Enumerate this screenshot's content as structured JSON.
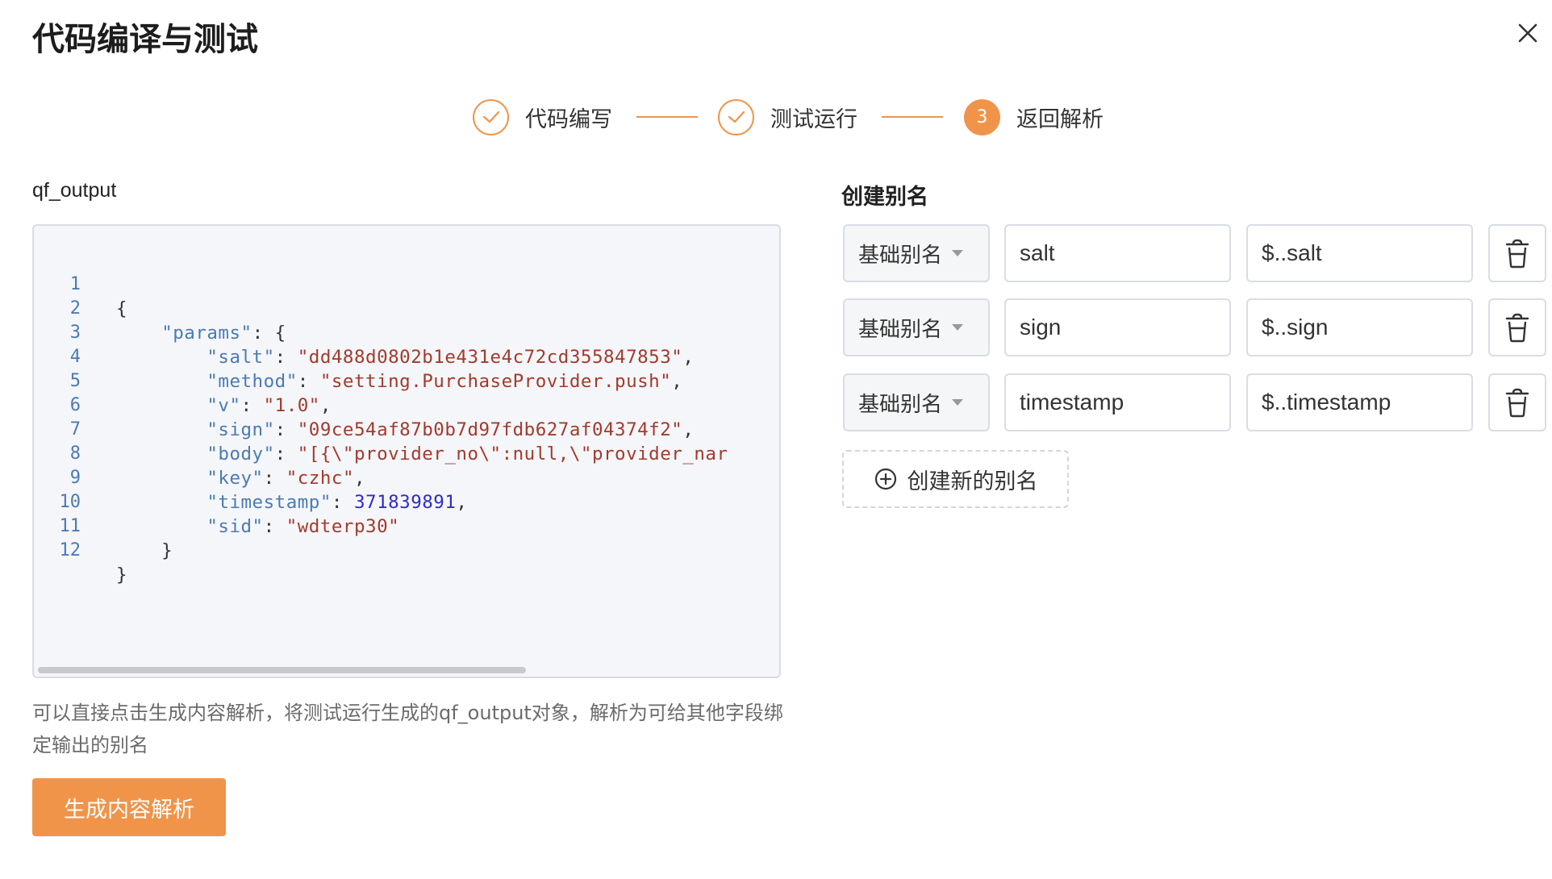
{
  "dialog": {
    "title": "代码编译与测试",
    "close_icon": "close-icon"
  },
  "steps": [
    {
      "label": "代码编写",
      "status": "finished",
      "icon": "check-icon"
    },
    {
      "label": "测试运行",
      "status": "finished",
      "icon": "check-icon"
    },
    {
      "label": "返回解析",
      "status": "active",
      "number": "3"
    }
  ],
  "output": {
    "label": "qf_output",
    "code_lines": [
      {
        "n": "1"
      },
      {
        "n": "2"
      },
      {
        "n": "3"
      },
      {
        "n": "4"
      },
      {
        "n": "5"
      },
      {
        "n": "6"
      },
      {
        "n": "7"
      },
      {
        "n": "8"
      },
      {
        "n": "9"
      },
      {
        "n": "10"
      },
      {
        "n": "11"
      },
      {
        "n": "12"
      }
    ],
    "json": {
      "params": {
        "salt": "dd488d0802b1e431e4c72cd355847853",
        "method": "setting.PurchaseProvider.push",
        "v": "1.0",
        "sign": "09ce54af87b0b7d97fdb627af04374f2",
        "body": "[{\\\"provider_no\\\":null,\\\"provider_nar",
        "key": "czhc",
        "timestamp": "371839891",
        "sid": "wdterp30"
      }
    },
    "hint": "可以直接点击生成内容解析，将测试运行生成的qf_output对象，解析为可给其他字段绑定输出的别名",
    "generate_button": "生成内容解析"
  },
  "aliases": {
    "title": "创建别名",
    "rows": [
      {
        "type": "基础别名",
        "name": "salt",
        "path": "$..salt"
      },
      {
        "type": "基础别名",
        "name": "sign",
        "path": "$..sign"
      },
      {
        "type": "基础别名",
        "name": "timestamp",
        "path": "$..timestamp"
      }
    ],
    "add_button": "创建新的别名"
  },
  "colors": {
    "accent": "#f0944a",
    "line_number": "#4a7ab5",
    "string": "#a33a2b",
    "number": "#2d2dc8"
  }
}
